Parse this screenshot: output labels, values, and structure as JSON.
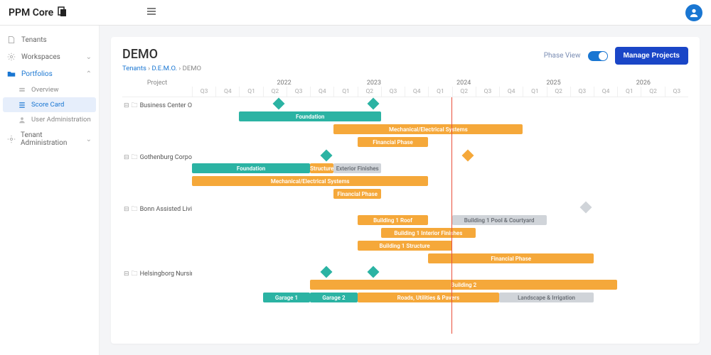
{
  "app": {
    "name": "PPM Core"
  },
  "sidebar": {
    "items": [
      {
        "label": "Tenants",
        "icon": "file"
      },
      {
        "label": "Workspaces",
        "icon": "gear",
        "chevron": true
      },
      {
        "label": "Portfolios",
        "icon": "folder",
        "chevron": true,
        "open": true
      },
      {
        "label": "Tenant Administration",
        "icon": "gear",
        "chevron": true
      }
    ],
    "subitems": [
      {
        "label": "Overview",
        "icon": "layers"
      },
      {
        "label": "Score Card",
        "icon": "list",
        "selected": true
      },
      {
        "label": "User Administration",
        "icon": "user"
      }
    ]
  },
  "page": {
    "title": "DEMO",
    "crumb1": "Tenants",
    "crumb2": "D.E.M.O.",
    "crumb3": "DEMO",
    "sep": "›",
    "phase_view": "Phase View",
    "manage_btn": "Manage Projects",
    "project_header": "Project"
  },
  "timeline": {
    "years": [
      "2022",
      "2023",
      "2024",
      "2025",
      "2026"
    ],
    "quarters": [
      "Q3",
      "Q4",
      "Q1",
      "Q2",
      "Q3",
      "Q4",
      "Q1",
      "Q2",
      "Q3",
      "Q4",
      "Q1",
      "Q2",
      "Q3",
      "Q4",
      "Q1",
      "Q2",
      "Q3",
      "Q4",
      "Q1",
      "Q2",
      "Q3"
    ]
  },
  "chart_data": {
    "type": "gantt",
    "time_axis": {
      "start": "2021-Q3",
      "end": "2026-Q3",
      "today": "2024-Q1"
    },
    "projects": [
      {
        "name": "Business Center Offic...",
        "milestones": [
          {
            "quarter": "2022-Q2",
            "color": "teal"
          },
          {
            "quarter": "2023-Q2",
            "color": "teal"
          }
        ],
        "bars": [
          {
            "label": "Foundation",
            "start": "2022-Q1",
            "end": "2023-Q3",
            "color": "teal"
          },
          {
            "label": "Mechanical/Electrical Systems",
            "start": "2023-Q1",
            "end": "2025-Q1",
            "color": "orange"
          },
          {
            "label": "Financial Phase",
            "start": "2023-Q2",
            "end": "2024-Q1",
            "color": "orange"
          }
        ]
      },
      {
        "name": "Gothenburg Corporat...",
        "milestones": [
          {
            "quarter": "2022-Q4",
            "color": "teal"
          },
          {
            "quarter": "2024-Q2",
            "color": "orange"
          }
        ],
        "bars": [
          {
            "label": "Foundation",
            "start": "2021-Q3",
            "end": "2022-Q4",
            "color": "teal"
          },
          {
            "label": "Structure",
            "start": "2022-Q4",
            "end": "2023-Q1",
            "color": "orange"
          },
          {
            "label": "Exterior Finishes",
            "start": "2023-Q1",
            "end": "2023-Q3",
            "color": "grey"
          },
          {
            "label": "Mechanical/Electrical Systems",
            "start": "2021-Q3",
            "end": "2024-Q1",
            "color": "orange"
          },
          {
            "label": "Financial Phase",
            "start": "2023-Q1",
            "end": "2023-Q3",
            "color": "orange"
          }
        ]
      },
      {
        "name": "Bonn Assisted Living ...",
        "milestones": [
          {
            "quarter": "2025-Q3",
            "color": "grey"
          }
        ],
        "bars": [
          {
            "label": "Building 1 Roof",
            "start": "2023-Q2",
            "end": "2024-Q1",
            "color": "orange"
          },
          {
            "label": "Building 1 Pool & Courtyard",
            "start": "2024-Q2",
            "end": "2025-Q2",
            "color": "grey"
          },
          {
            "label": "Building 1 Interior Finishes",
            "start": "2023-Q3",
            "end": "2024-Q3",
            "color": "orange"
          },
          {
            "label": "Building 1 Structure",
            "start": "2023-Q2",
            "end": "2024-Q2",
            "color": "orange"
          },
          {
            "label": "Financial Phase",
            "start": "2024-Q1",
            "end": "2025-Q4",
            "color": "orange"
          }
        ]
      },
      {
        "name": "Helsingborg Nursing ...",
        "milestones": [
          {
            "quarter": "2022-Q4",
            "color": "teal"
          },
          {
            "quarter": "2023-Q2",
            "color": "teal"
          }
        ],
        "bars": [
          {
            "label": "Building 2",
            "start": "2022-Q4",
            "end": "2026-Q1",
            "color": "orange"
          },
          {
            "label": "Garage 1",
            "start": "2022-Q2",
            "end": "2022-Q4",
            "color": "teal"
          },
          {
            "label": "Garage 2",
            "start": "2022-Q4",
            "end": "2023-Q2",
            "color": "teal"
          },
          {
            "label": "Roads, Utilities & Pavers",
            "start": "2023-Q2",
            "end": "2024-Q4",
            "color": "orange"
          },
          {
            "label": "Landscape & Irrigation",
            "start": "2024-Q4",
            "end": "2025-Q4",
            "color": "grey"
          }
        ]
      }
    ]
  }
}
